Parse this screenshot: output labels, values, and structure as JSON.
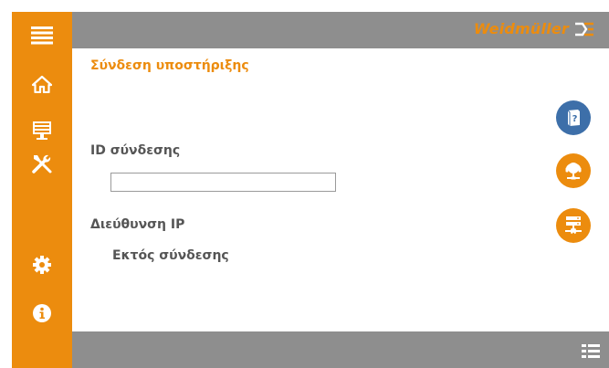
{
  "brand": {
    "name": "Weidmüller"
  },
  "page": {
    "title": "Σύνδεση υποστήριξης",
    "connection_id_label": "ID σύνδεσης",
    "connection_id_value": "",
    "ip_address_label": "Διεύθυνση IP",
    "ip_status": "Εκτός σύνδεσης"
  },
  "sidebar": {
    "items": [
      {
        "icon": "menu-icon"
      },
      {
        "icon": "home-icon"
      },
      {
        "icon": "monitor-icon"
      },
      {
        "icon": "tools-icon"
      },
      {
        "icon": "gear-icon"
      },
      {
        "icon": "info-icon"
      }
    ]
  },
  "actions": [
    {
      "icon": "help-book-icon",
      "color": "#3d6fa9"
    },
    {
      "icon": "support-headset-icon",
      "color": "#ec8c0e"
    },
    {
      "icon": "network-server-icon",
      "color": "#ec8c0e"
    }
  ],
  "colors": {
    "accent": "#ec8c0e",
    "bar": "#8e8e8e",
    "help": "#3d6fa9"
  }
}
